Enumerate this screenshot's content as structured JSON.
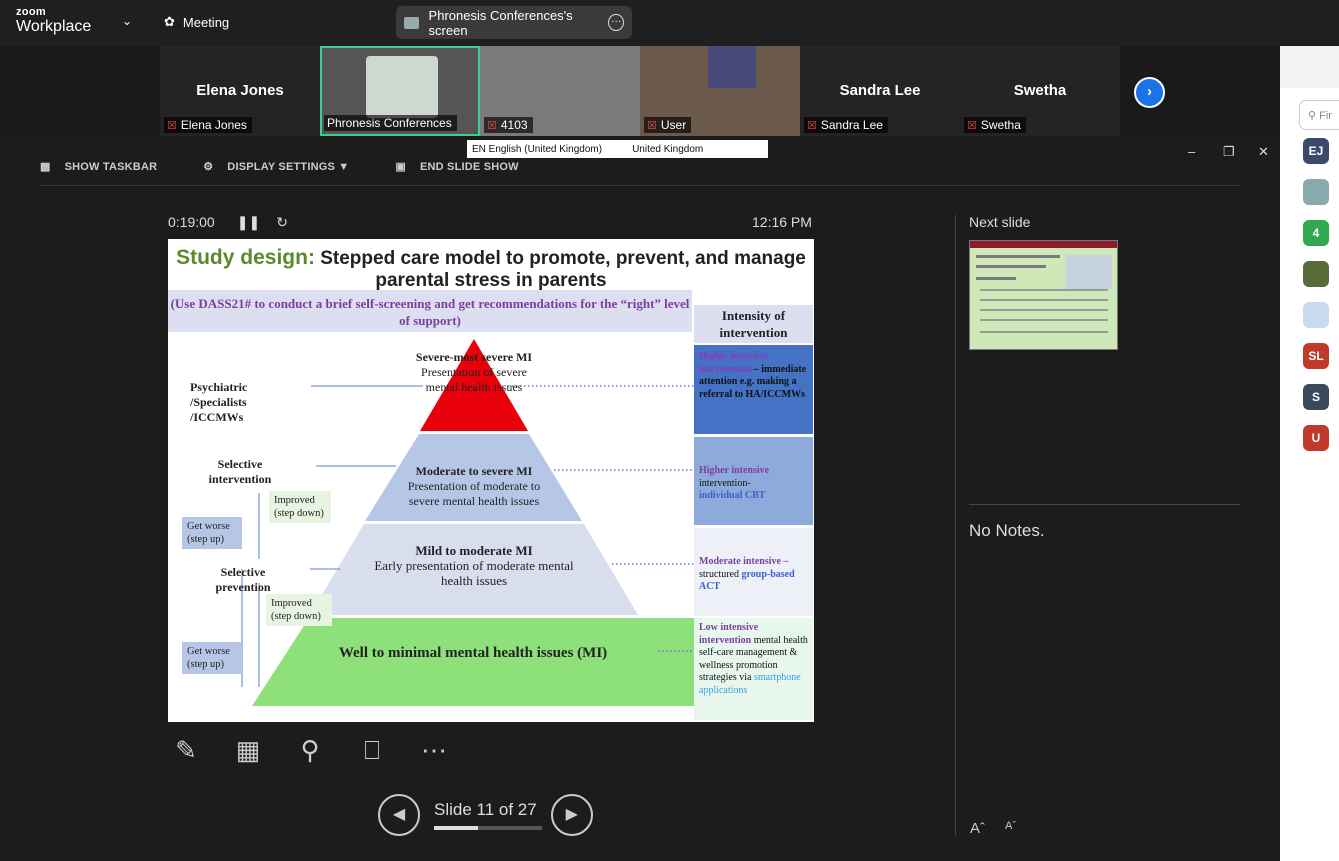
{
  "app": {
    "brand_top": "zoom",
    "brand_bottom": "Workplace",
    "meeting_label": "Meeting",
    "share_pill": "Phronesis Conferences's screen"
  },
  "participants": [
    {
      "name": "Elena Jones",
      "label": "Elena Jones",
      "muted": true
    },
    {
      "name": "",
      "label": "Phronesis Conferences",
      "muted": false,
      "active": true
    },
    {
      "name": "",
      "label": "4103",
      "muted": true
    },
    {
      "name": "",
      "label": "User",
      "muted": true
    },
    {
      "name": "Sandra Lee",
      "label": "Sandra Lee",
      "muted": true
    },
    {
      "name": "Swetha",
      "label": "Swetha",
      "muted": true
    }
  ],
  "lang_bar": {
    "left": "EN English (United Kingdom)",
    "right": "United Kingdom"
  },
  "presenter_toolbar": {
    "taskbar": "SHOW TASKBAR",
    "display": "DISPLAY SETTINGS ▼",
    "end": "END SLIDE SHOW"
  },
  "presenter": {
    "elapsed": "0:19:00",
    "clock": "12:16 PM",
    "next_slide_label": "Next slide",
    "notes": "No Notes.",
    "slide_counter": "Slide 11 of 27",
    "progress": 0.41
  },
  "slide": {
    "title_prefix": "Study design:",
    "title_rest": "Stepped care model to promote, prevent, and manage parental stress in parents",
    "band": "(Use DASS21# to conduct a brief self-screening and get recommendations for the “right” level of support)",
    "intensity_header": "Intensity of intervention",
    "tiers": [
      {
        "head": "Severe-most severe MI",
        "body": "Presentation of severe mental health issues"
      },
      {
        "head": "Moderate to severe MI",
        "body": "Presentation of moderate to severe mental health issues"
      },
      {
        "head": "Mild to moderate MI",
        "body": "Early presentation of moderate mental health issues"
      },
      {
        "head": "Well to minimal mental health issues (MI)",
        "body": ""
      }
    ],
    "left_labels": [
      "Psychiatric /Specialists /ICCMWs",
      "Selective intervention",
      "Selective prevention"
    ],
    "improved": "Improved (step down)",
    "worse": "Get worse (step up)",
    "intensity": [
      {
        "a": "Highly intensive intervention",
        "b": " – immediate attention e.g. making a referral to HA/ICCMWs"
      },
      {
        "a": "Higher intensive",
        "b": " intervention-",
        "c": "individual CBT"
      },
      {
        "a": "Moderate intensive –",
        "b": " structured ",
        "c": "group-based ACT"
      },
      {
        "a": "Low intensive intervention",
        "b": " mental health self-care management & wellness promotion strategies via ",
        "c": "smartphone applications"
      }
    ]
  },
  "sidebar_avatars": [
    {
      "text": "EJ",
      "color": "#3b4a6b"
    },
    {
      "text": "",
      "color": "#8aa"
    },
    {
      "text": "4",
      "color": "#2fa84f"
    },
    {
      "text": "",
      "color": "#5a6b3a"
    },
    {
      "text": "",
      "color": "#c9d9ef"
    },
    {
      "text": "SL",
      "color": "#c0392b"
    },
    {
      "text": "S",
      "color": "#3b4a5b"
    },
    {
      "text": "U",
      "color": "#c0392b"
    }
  ],
  "search_placeholder": "Fir"
}
